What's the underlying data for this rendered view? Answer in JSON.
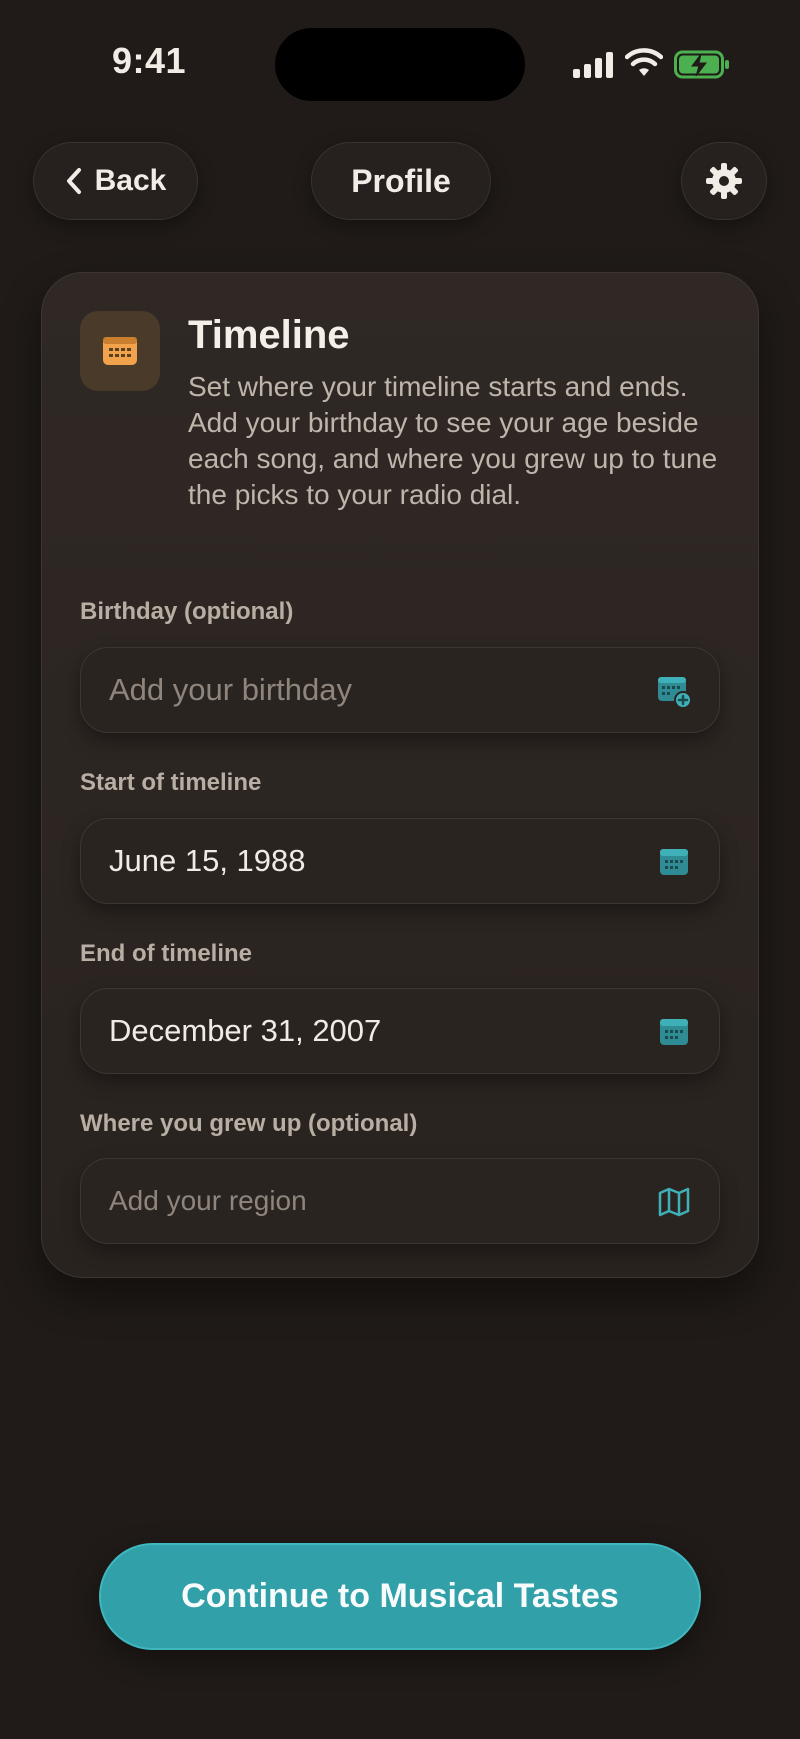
{
  "status_bar": {
    "time": "9:41"
  },
  "nav": {
    "back_label": "Back",
    "title": "Profile"
  },
  "card": {
    "title": "Timeline",
    "description": "Set where your timeline starts and ends. Add your birthday to see your age beside each song, and where you grew up to tune the picks to your radio dial.",
    "fields": [
      {
        "label": "Birthday (optional)",
        "value": "",
        "placeholder": "Add your birthday",
        "icon": "calendar-add-icon"
      },
      {
        "label": "Start of timeline",
        "value": "June 15, 1988",
        "placeholder": "",
        "icon": "calendar-icon"
      },
      {
        "label": "End of timeline",
        "value": "December 31, 2007",
        "placeholder": "",
        "icon": "calendar-icon"
      },
      {
        "label": "Where you grew up (optional)",
        "value": "",
        "placeholder": "Add your region",
        "icon": "map-icon"
      }
    ]
  },
  "cta": {
    "label": "Continue to Musical Tastes"
  },
  "colors": {
    "accent": "#31a0a8",
    "icon_orange": "#f0a34a",
    "background": "#201b18"
  }
}
